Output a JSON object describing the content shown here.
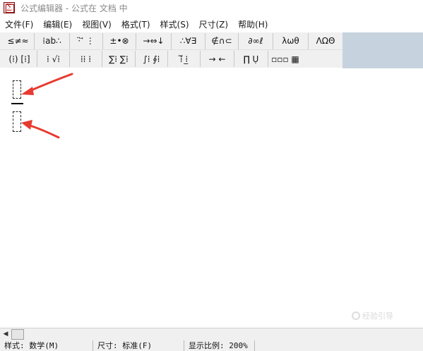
{
  "window": {
    "title": "公式编辑器 - 公式在 文档 中"
  },
  "menu": [
    {
      "id": "file",
      "label": "文件(F)"
    },
    {
      "id": "edit",
      "label": "编辑(E)"
    },
    {
      "id": "view",
      "label": "视图(V)"
    },
    {
      "id": "format",
      "label": "格式(T)"
    },
    {
      "id": "style",
      "label": "样式(S)"
    },
    {
      "id": "size",
      "label": "尺寸(Z)"
    },
    {
      "id": "help",
      "label": "帮助(H)"
    }
  ],
  "toolbar": {
    "row1": [
      {
        "id": "relations",
        "label": "≤≠≈"
      },
      {
        "id": "spaces",
        "label": "⁞ab∴"
      },
      {
        "id": "embellish",
        "label": "·̈ ⃗ ⋮"
      },
      {
        "id": "operators",
        "label": "±•⊗"
      },
      {
        "id": "arrows",
        "label": "→⇔↓"
      },
      {
        "id": "logic",
        "label": "∴∀∃"
      },
      {
        "id": "sets",
        "label": "∉∩⊂"
      },
      {
        "id": "misc",
        "label": "∂∞ℓ"
      },
      {
        "id": "greek-lower",
        "label": "λωθ"
      },
      {
        "id": "greek-upper",
        "label": "ΛΩΘ"
      }
    ],
    "row2": [
      {
        "id": "fences",
        "label": "(⁞) [⁞]"
      },
      {
        "id": "fractions",
        "label": "⁞ √⁞"
      },
      {
        "id": "subscripts",
        "label": "⁞⁞ ⁞"
      },
      {
        "id": "summations",
        "label": "∑⁞ ∑⁞"
      },
      {
        "id": "integrals",
        "label": "∫⁞ ∮⁞"
      },
      {
        "id": "underbars",
        "label": "⁞̅ ⁞̲"
      },
      {
        "id": "labeled-arrows",
        "label": "→ ←"
      },
      {
        "id": "products",
        "label": "∏ Ụ"
      },
      {
        "id": "matrices",
        "label": "▫▫▫ ▦"
      }
    ]
  },
  "statusbar": {
    "style": "样式: 数学(M)",
    "size": "尺寸: 标准(F)",
    "zoom": "显示比例: 200%"
  },
  "watermark": {
    "text": "经验引导"
  },
  "colors": {
    "arrow": "#e83a30",
    "toolbar_bg": "#f0f0f0",
    "toolbar_accent": "#c6d3df"
  }
}
